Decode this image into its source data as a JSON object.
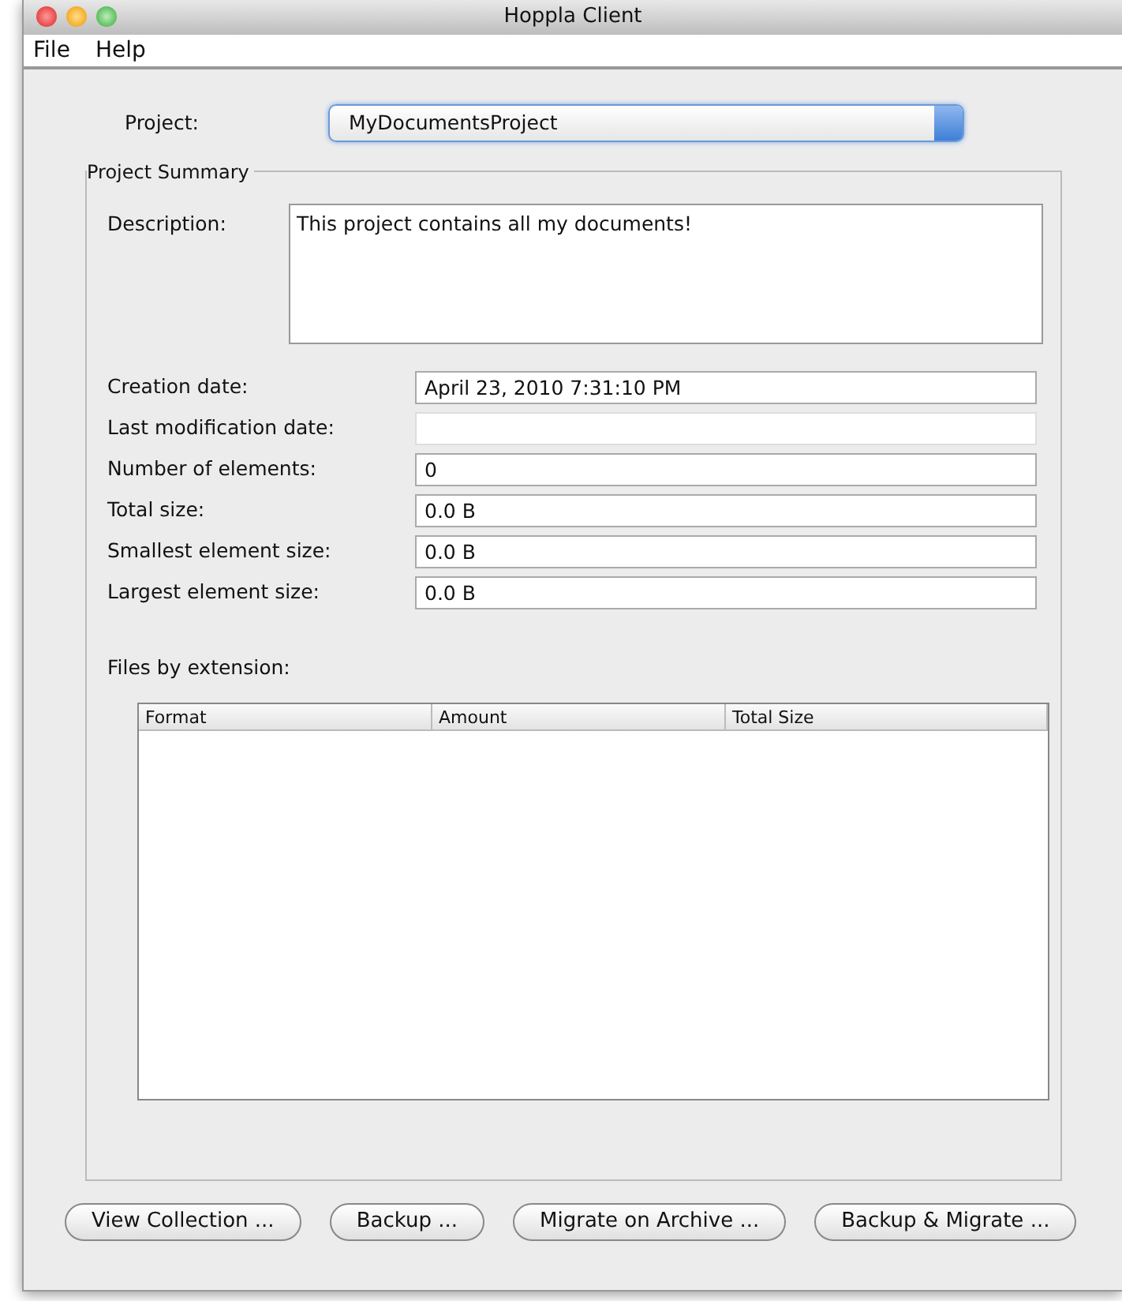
{
  "window": {
    "title": "Hoppla Client"
  },
  "menu": [
    "File",
    "Help"
  ],
  "project": {
    "label": "Project:",
    "value": "MyDocumentsProject"
  },
  "summary": {
    "title": "Project Summary",
    "description_label": "Description:",
    "description": "This project contains all my documents!",
    "fields": [
      {
        "label": "Creation date:",
        "value": "April 23, 2010 7:31:10 PM"
      },
      {
        "label": "Last modification date:"
      },
      {
        "label": "Number of elements:",
        "value": "0"
      },
      {
        "label": "Total size:",
        "value": "0.0 B"
      },
      {
        "label": "Smallest element size:",
        "value": "0.0 B"
      },
      {
        "label": "Largest element size:",
        "value": "0.0 B"
      }
    ],
    "files_label": "Files by extension:",
    "table": {
      "columns": [
        "Format",
        "Amount",
        "Total Size"
      ]
    }
  },
  "buttons": [
    "View Collection ...",
    "Backup ...",
    "Migrate on Archive ...",
    "Backup & Migrate ..."
  ]
}
